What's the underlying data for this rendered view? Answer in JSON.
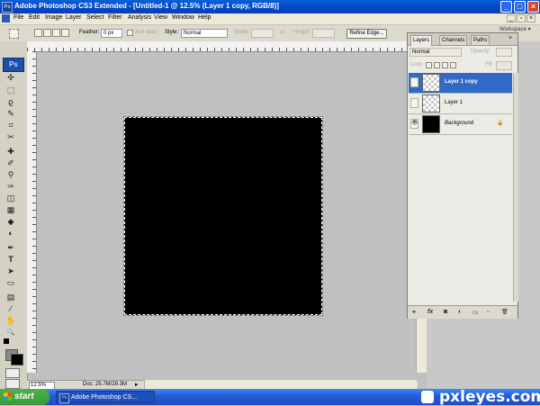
{
  "window": {
    "title": "Adobe Photoshop CS3 Extended - [Untitled-1 @ 12.5% (Layer 1 copy, RGB/8)]",
    "app_icon": "Ps",
    "min": "_",
    "max": "□",
    "close": "×"
  },
  "menu": [
    "File",
    "Edit",
    "Image",
    "Layer",
    "Select",
    "Filter",
    "Analysis",
    "View",
    "Window",
    "Help"
  ],
  "doc_buttons": {
    "min": "_",
    "restore": "▫",
    "close": "×"
  },
  "options": {
    "feather_label": "Feather:",
    "feather_value": "0 px",
    "antialias_label": "Anti-alias",
    "style_label": "Style:",
    "style_value": "Normal",
    "width_label": "Width:",
    "height_label": "Height:",
    "refine_edge": "Refine Edge..."
  },
  "workspace": "Workspace ▾",
  "toolbox": {
    "logo": "Ps",
    "tools": [
      "move",
      "marquee",
      "lasso",
      "quick-select",
      "crop",
      "slice",
      "healing",
      "brush",
      "stamp",
      "history-brush",
      "eraser",
      "gradient",
      "blur",
      "dodge",
      "pen",
      "type",
      "path-select",
      "shape",
      "notes",
      "eyedropper",
      "hand",
      "zoom"
    ],
    "glyphs": [
      "✣",
      "⬚",
      "ϱ",
      "✎",
      "⌗",
      "✂",
      "✚",
      "✐",
      "⚲",
      "✑",
      "◫",
      "▦",
      "◆",
      "◐",
      "✒",
      "T",
      "➤",
      "▭",
      "▤",
      "⁄",
      "✋",
      "🔍"
    ]
  },
  "status": {
    "zoom": "12.5%",
    "doc": "Doc: 25.7M/29.3M"
  },
  "layers_panel": {
    "tabs": [
      "Layers",
      "Channels",
      "Paths"
    ],
    "close": "×",
    "blend_mode": "Normal",
    "opacity_label": "Opacity:",
    "lock_label": "Lock:",
    "fill_label": "Fill:",
    "layers": [
      {
        "name": "Layer 1 copy",
        "selected": true,
        "visible": false,
        "thumb": "transparent"
      },
      {
        "name": "Layer 1",
        "selected": false,
        "visible": false,
        "thumb": "transparent"
      },
      {
        "name": "Background",
        "selected": false,
        "visible": true,
        "thumb": "black",
        "locked": true
      }
    ],
    "eye_glyph": "👁",
    "lock_glyph": "🔒",
    "footer_icons": [
      "link-icon",
      "fx-icon",
      "mask-icon",
      "adjustment-icon",
      "folder-icon",
      "new-layer-icon",
      "trash-icon"
    ],
    "footer_glyphs": [
      "⚭",
      "fx",
      "◙",
      "◐",
      "▭",
      "▫",
      "🗑"
    ]
  },
  "taskbar": {
    "start": "start",
    "task": "Adobe Photoshop CS...",
    "task_icon": "Ps",
    "watermark": "pxleyes.com"
  }
}
